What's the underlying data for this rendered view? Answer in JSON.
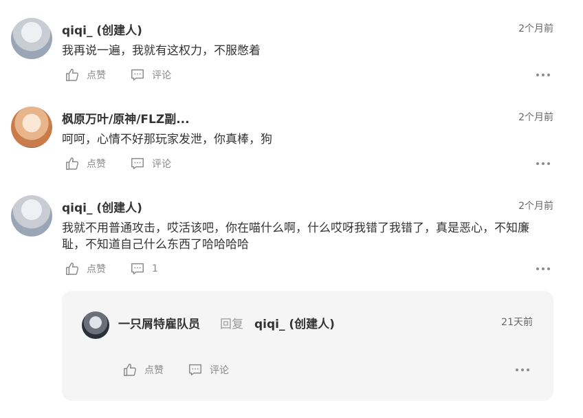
{
  "comments": [
    {
      "author": "qiqi_ (创建人)",
      "time": "2个月前",
      "text": "我再说一遍，我就有这权力，不服憋着",
      "like_label": "点赞",
      "comment_label": "评论"
    },
    {
      "author": "枫原万叶/原神/FLZ副...",
      "time": "2个月前",
      "text": "呵呵，心情不好那玩家发泄，你真棒，狗",
      "like_label": "点赞",
      "comment_label": "评论"
    },
    {
      "author": "qiqi_ (创建人)",
      "time": "2个月前",
      "text_line1": "我就不用普通攻击，哎活该吧，你在喵什么啊，什么哎呀我错了我错了，真是恶心，不知廉",
      "text_line2": "耻，不知道自己什么东西了哈哈哈哈",
      "like_label": "点赞",
      "comment_count": "1"
    }
  ],
  "reply": {
    "author": "一只屑特雇队员",
    "reply_word": "回复",
    "reply_to": "qiqi_ (创建人)",
    "time": "21天前",
    "like_label": "点赞",
    "comment_label": "评论"
  },
  "icons": [
    "thumbs-up-icon",
    "comment-icon",
    "more-icon"
  ]
}
